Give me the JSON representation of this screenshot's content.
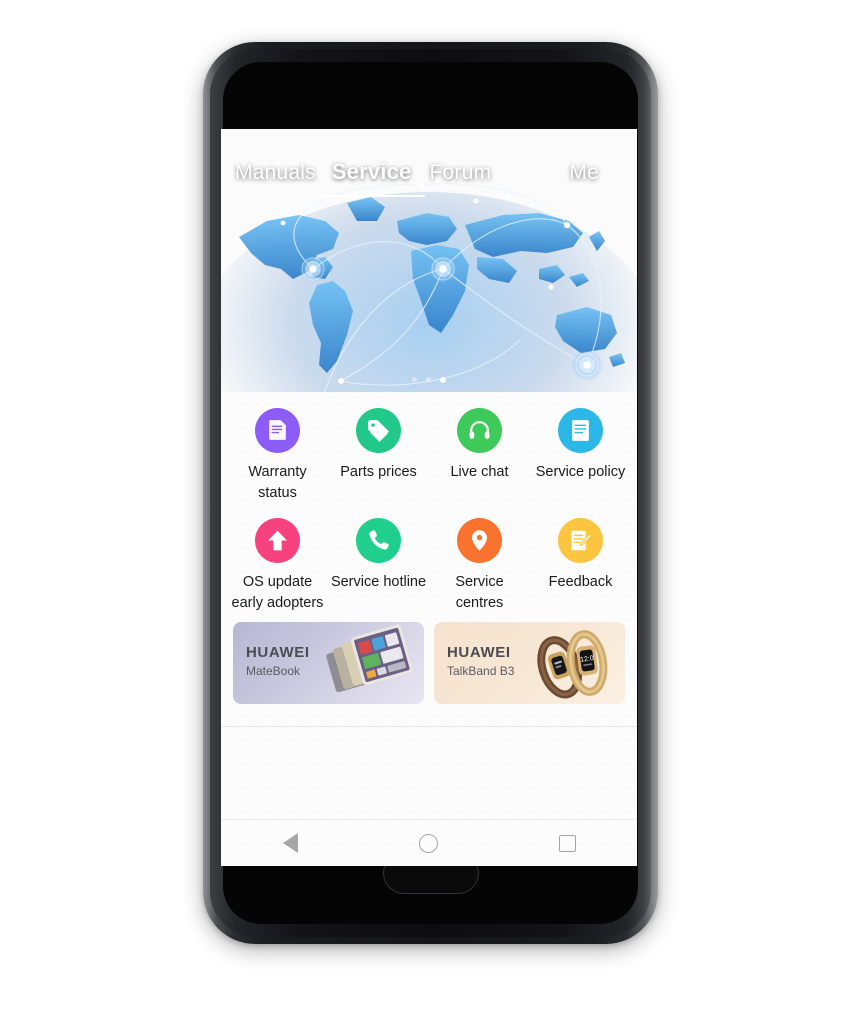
{
  "device": {
    "hardware": {
      "front_camera": "front-camera",
      "earpiece": "earpiece-speaker",
      "home_button": "home-button",
      "volume_rocker": "volume-rocker",
      "power_button": "power-button"
    }
  },
  "hero": {
    "tabs": [
      {
        "label": "Manuals",
        "active": false
      },
      {
        "label": "Service",
        "active": true
      },
      {
        "label": "Forum",
        "active": false
      },
      {
        "label": "Me",
        "active": false
      }
    ],
    "carousel": {
      "total_dots": 3,
      "active_index": 2
    },
    "background_colors": {
      "sky_dark": "#061633",
      "sky_mid": "#0c2c60",
      "ocean": "#14407e",
      "landmass": "#4aa0e8",
      "node_glow": "#ffffff"
    }
  },
  "grid": {
    "items": [
      {
        "label": "Warranty status",
        "icon": "document-lines-icon",
        "color": "#8b5cf6"
      },
      {
        "label": "Parts prices",
        "icon": "price-tag-icon",
        "color": "#21c88a"
      },
      {
        "label": "Live chat",
        "icon": "headset-icon",
        "color": "#3ec95b"
      },
      {
        "label": "Service policy",
        "icon": "document-icon",
        "color": "#2bb7e8"
      },
      {
        "label": "OS update early adopters",
        "icon": "arrow-up-icon",
        "color": "#f8417f"
      },
      {
        "label": "Service hotline",
        "icon": "phone-icon",
        "color": "#20ce8d"
      },
      {
        "label": "Service centres",
        "icon": "location-pin-icon",
        "color": "#f9722e"
      },
      {
        "label": "Feedback",
        "icon": "feedback-edit-icon",
        "color": "#fcc53f"
      }
    ]
  },
  "banners": [
    {
      "brand": "HUAWEI",
      "model": "MateBook",
      "art": "laptop-tablet-art",
      "bg": "#c4c3dc"
    },
    {
      "brand": "HUAWEI",
      "model": "TalkBand B3",
      "art": "smartband-art",
      "bg": "#f6e5d1"
    }
  ],
  "navbar": {
    "buttons": [
      {
        "name": "back",
        "icon": "triangle-back-icon"
      },
      {
        "name": "home",
        "icon": "circle-home-icon"
      },
      {
        "name": "recents",
        "icon": "square-recents-icon"
      }
    ],
    "icon_color": "#a6a6a6"
  }
}
